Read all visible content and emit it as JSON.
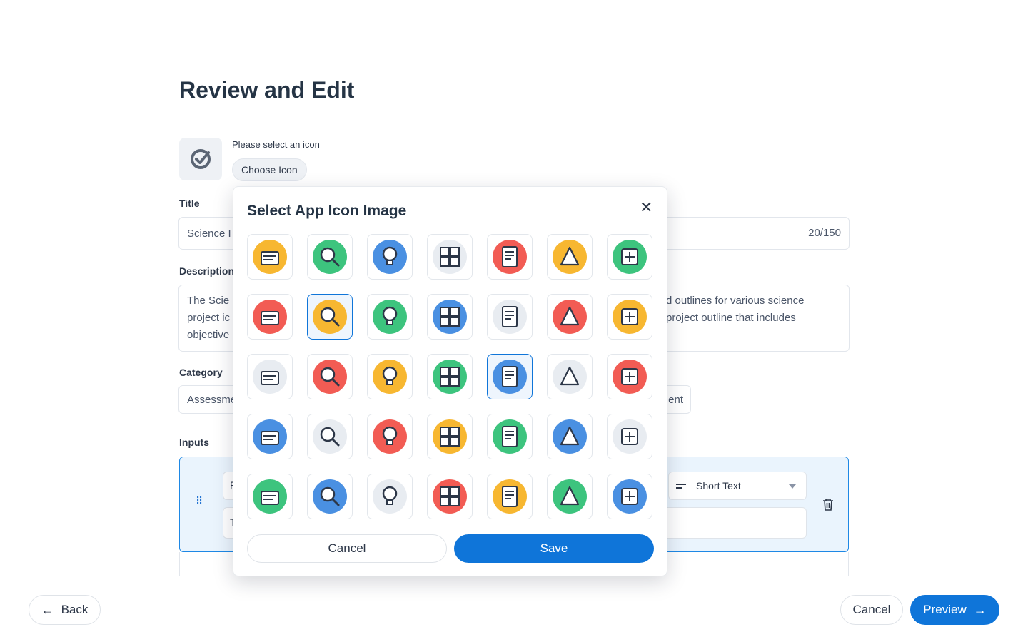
{
  "page": {
    "title": "Review and Edit"
  },
  "icon_picker": {
    "hint": "Please select an icon",
    "choose_label": "Choose Icon",
    "current_icon": "check-circle-icon"
  },
  "form": {
    "title_label": "Title",
    "title_value": "Science I",
    "title_counter": "20/150",
    "description_label": "Description",
    "description_left_lines": [
      "The Scie",
      "project ic",
      "objective"
    ],
    "description_right_lines": [
      "d outlines for various science",
      "project outline that includes"
    ],
    "category_label": "Category",
    "category_value": "Assessme",
    "category_value_right": "ent",
    "inputs_label": "Inputs",
    "input_type": "Short Text",
    "input_name_fragment": "F",
    "input_desc_fragment": "T"
  },
  "footer": {
    "back_label": "Back",
    "cancel_label": "Cancel",
    "preview_label": "Preview"
  },
  "modal": {
    "title": "Select App Icon Image",
    "cancel_label": "Cancel",
    "save_label": "Save",
    "selected_index": 8,
    "icons": [
      "graduation-globe-icon",
      "globe-magnifier-icon",
      "idea-book-icon",
      "puzzle-icon",
      "diploma-certificate-icon",
      "abc-blocks-icon",
      "open-book-plant-icon",
      "books-pencil-icon",
      "science-flasks-icon",
      "flask-hand-icon",
      "alphabet-cards-icon",
      "abcd-book-icon",
      "microchip-book-icon",
      "lightbulb-icon",
      "book-pencil-ruler-icon",
      "online-lesson-icon",
      "team-connection-icon",
      "math-tablet-ruler-icon",
      "geometry-icon",
      "medal-star-icon",
      "microphone-icon",
      "mountain-flag-icon",
      "mountains-sun-icon",
      "calendar-icon",
      "tablet-gears-icon",
      "graduation-cap-icon",
      "stacked-books-icon",
      "binders-icon",
      "magnifier-box-icon",
      "notebook-pencil-icon",
      "chart-board-icon",
      "graduation-cap-book-icon",
      "school-building-icon",
      "laptop-search-icon",
      "school-flag-icon"
    ]
  },
  "colors": {
    "primary": "#0f75d9",
    "text": "#253445",
    "border": "#e2e6ec",
    "selected_panel_bg": "#eaf4fd",
    "icon_yellow": "#f7b731",
    "icon_blue": "#4a90e2",
    "icon_red": "#f25c54",
    "icon_green": "#3dc47e"
  }
}
